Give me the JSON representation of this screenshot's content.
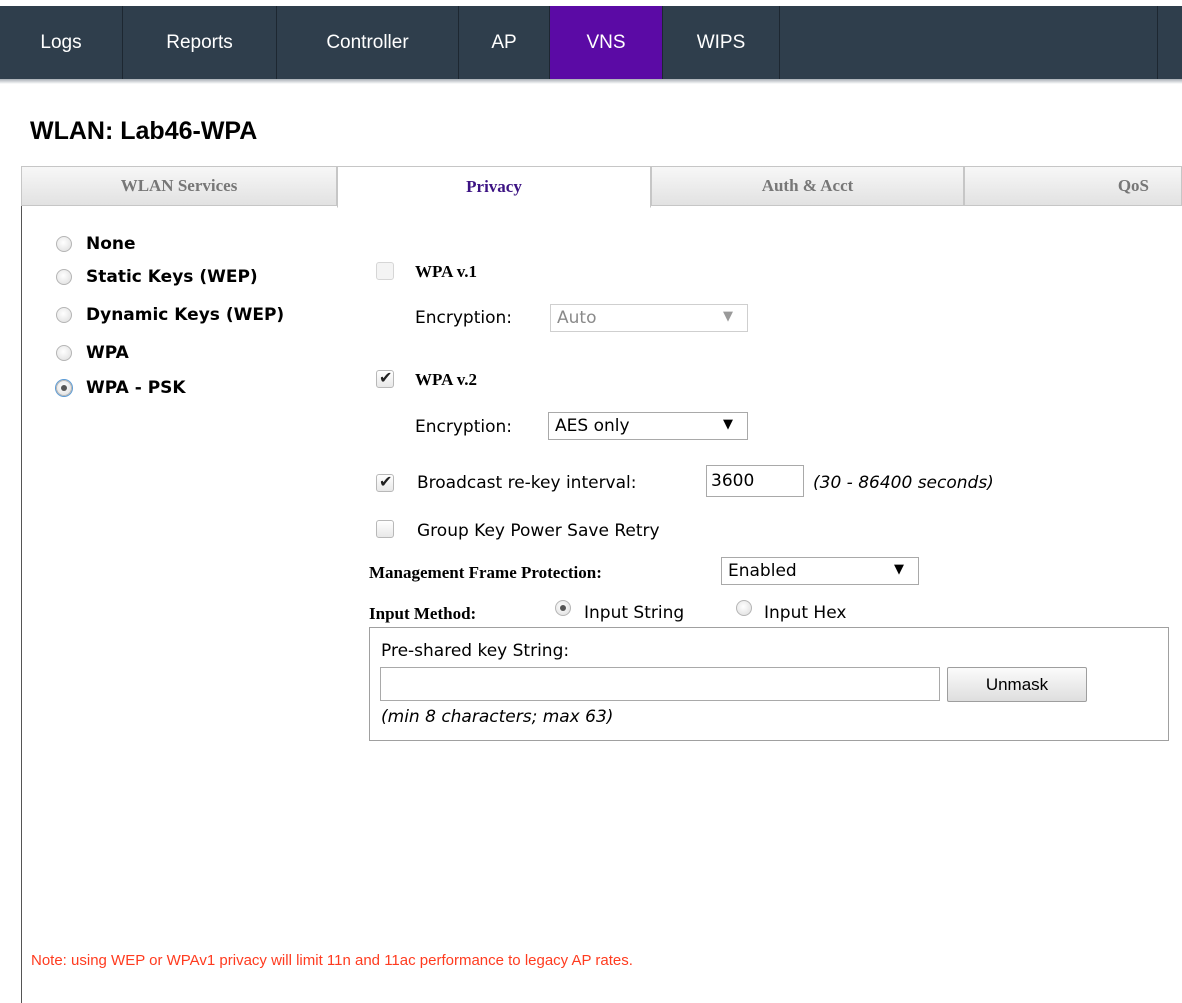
{
  "nav": {
    "tabs": [
      {
        "label": "Logs"
      },
      {
        "label": "Reports"
      },
      {
        "label": "Controller"
      },
      {
        "label": "AP"
      },
      {
        "label": "VNS",
        "active": true
      },
      {
        "label": "WIPS"
      }
    ]
  },
  "page": {
    "title": "WLAN: Lab46-WPA"
  },
  "tabs": [
    {
      "label": "WLAN Services"
    },
    {
      "label": "Privacy",
      "active": true
    },
    {
      "label": "Auth & Acct"
    },
    {
      "label": "QoS"
    }
  ],
  "privacy_options": [
    {
      "label": "None",
      "selected": false
    },
    {
      "label": "Static Keys (WEP)",
      "selected": false
    },
    {
      "label": "Dynamic Keys (WEP)",
      "selected": false
    },
    {
      "label": "WPA",
      "selected": false
    },
    {
      "label": "WPA - PSK",
      "selected": true
    }
  ],
  "wpa1": {
    "label": "WPA v.1",
    "checked": false,
    "enabled": false,
    "encryption_label": "Encryption:",
    "encryption_value": "Auto"
  },
  "wpa2": {
    "label": "WPA v.2",
    "checked": true,
    "encryption_label": "Encryption:",
    "encryption_value": "AES only"
  },
  "rekey": {
    "label": "Broadcast re-key interval:",
    "checked": true,
    "value": "3600",
    "hint": "(30 - 86400 seconds)"
  },
  "group_key": {
    "label": "Group Key Power Save Retry",
    "checked": false
  },
  "mfp": {
    "label": "Management Frame Protection:",
    "value": "Enabled"
  },
  "input_method": {
    "label": "Input Method:",
    "options": [
      {
        "label": "Input String",
        "selected": true
      },
      {
        "label": "Input Hex",
        "selected": false
      }
    ]
  },
  "psk": {
    "label": "Pre-shared key String:",
    "value": "",
    "unmask_label": "Unmask",
    "hint": "(min 8 characters; max 63)"
  },
  "note": "Note: using WEP or WPAv1 privacy will limit 11n and 11ac performance to legacy AP rates.",
  "colors": {
    "nav_bg": "#2f3e4c",
    "nav_active": "#5b0aa5",
    "tab_active_text": "#3c1383",
    "note_text": "#ff3b1f"
  }
}
